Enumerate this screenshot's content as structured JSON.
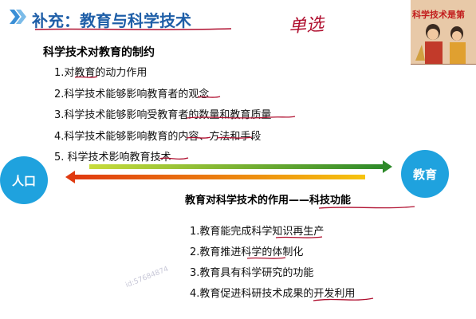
{
  "title": {
    "text": "补充：教育与科学技术"
  },
  "handnote": {
    "text": "单选"
  },
  "poster": {
    "text": "科学技术是第"
  },
  "section1": {
    "heading": "科学技术对教育的制约",
    "items": [
      "1.对教育的动力作用",
      "2.科学技术能够影响教育者的观念",
      "3.科学技术能够影响受教育者的数量和教育质量",
      "4.科学技术能够影响教育的内容、方法和手段",
      "5. 科学技术影响教育技术"
    ]
  },
  "diagram": {
    "left_label": "人口",
    "right_label": "教育"
  },
  "section2": {
    "heading": "教育对科学技术的作用——科技功能",
    "items": [
      "1.教育能完成科学知识再生产",
      "2.教育推进科学的体制化",
      "3.教育具有科学研究的功能",
      "4.教育促进科研技术成果的开发利用"
    ]
  },
  "watermark": {
    "text": "id:57684874"
  },
  "colors": {
    "title": "#1f5fa8",
    "circle": "#1fa2de",
    "ink": "#b01030",
    "arrow_top": "#5aa02c",
    "arrow_bottom": "#e85a0c"
  }
}
